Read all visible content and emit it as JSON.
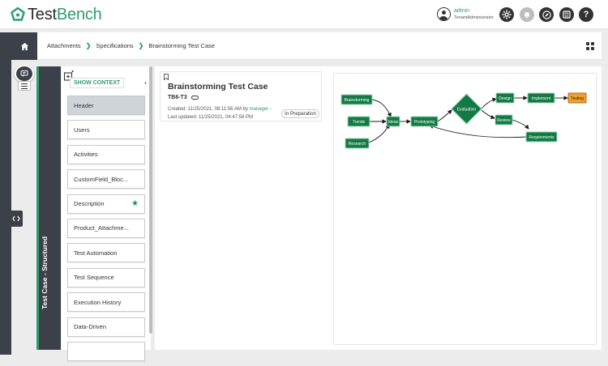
{
  "app": {
    "logo_part1": "Test",
    "logo_part2": "Bench",
    "user_name": "admin",
    "user_role": "TenantAdministrator"
  },
  "topbar_icons": [
    "gear-icon",
    "bell-icon",
    "compass-icon",
    "calculator-icon",
    "help-icon"
  ],
  "breadcrumb": {
    "items": [
      "Attachments",
      "Specifications",
      "Brainstorming Test Case"
    ]
  },
  "section_title": "Test Case - Structured",
  "context": {
    "show_context": "SHOW CONTEXT",
    "items": [
      "Header",
      "Users",
      "Activities",
      "CustomField_Bloc...",
      "Description",
      "Product_Attachme...",
      "Test Automation",
      "Test Sequence",
      "Execution History",
      "Data-Driven"
    ]
  },
  "card": {
    "title": "Brainstorming Test Case",
    "id": "TB6-T3",
    "created_prefix": "Created: 11/25/2021, 08:11:56 AM by",
    "created_user": "manager",
    "created_suffix": " -",
    "updated": "Last updated: 11/25/2021, 04:47:58 PM",
    "status": "In Preparation"
  },
  "diagram": {
    "nodes": {
      "brainstorming": "Brainstorming",
      "trends": "Trends",
      "research": "Research",
      "ideas": "Ideas",
      "prototyping": "Prototyping",
      "evaluation": "Evaluation",
      "design": "Design",
      "implement": "Implement",
      "testing": "Testing",
      "review": "Review",
      "requirements": "Requirements"
    },
    "colors": {
      "node_fill": "#137a45",
      "node_border": "#9bd6b3",
      "highlight_fill": "#f0a030",
      "edge": "#1a1a1a"
    }
  }
}
